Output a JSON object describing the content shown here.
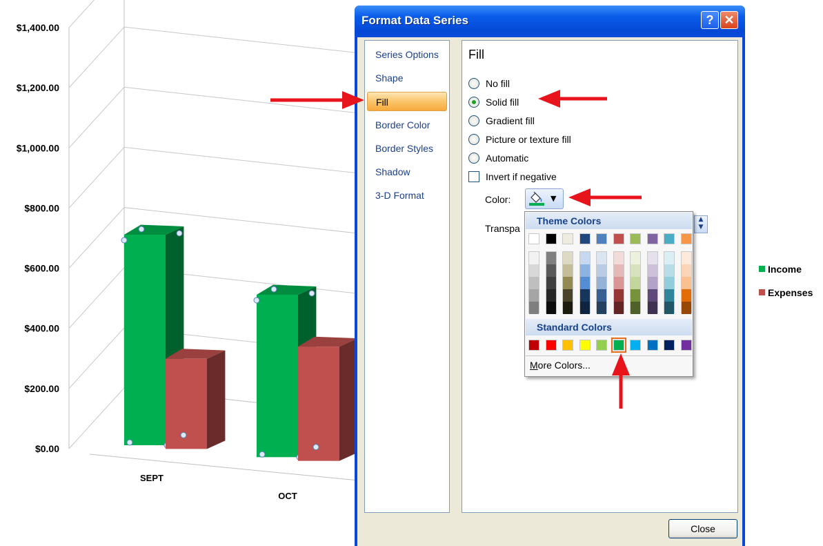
{
  "chart_data": {
    "type": "bar",
    "categories": [
      "SEPT",
      "OCT"
    ],
    "series": [
      {
        "name": "Income",
        "color": "#00b050",
        "values": [
          700,
          540
        ]
      },
      {
        "name": "Expenses",
        "color": "#c0504d",
        "values": [
          300,
          380
        ]
      }
    ],
    "ylim": [
      0,
      1400
    ],
    "yticks": [
      "$0.00",
      "$200.00",
      "$400.00",
      "$600.00",
      "$800.00",
      "$1,000.00",
      "$1,200.00",
      "$1,400.00"
    ],
    "grid": true,
    "legend_position": "right",
    "style": "3-D clustered column"
  },
  "dialog": {
    "title": "Format Data Series",
    "help_label": "?",
    "close_x_label": "✕",
    "nav_items": [
      {
        "label": "Series Options"
      },
      {
        "label": "Shape"
      },
      {
        "label": "Fill"
      },
      {
        "label": "Border Color"
      },
      {
        "label": "Border Styles"
      },
      {
        "label": "Shadow"
      },
      {
        "label": "3-D Format"
      }
    ],
    "selected_nav": "Fill",
    "fill": {
      "heading": "Fill",
      "options": [
        {
          "label": "No fill",
          "checked": false
        },
        {
          "label": "Solid fill",
          "checked": true
        },
        {
          "label": "Gradient fill",
          "checked": false
        },
        {
          "label": "Picture or texture fill",
          "checked": false
        },
        {
          "label": "Automatic",
          "checked": false
        }
      ],
      "invert_label": "Invert if negative",
      "invert_checked": false,
      "color_label": "Color:",
      "color_button_icon": "paint-bucket-icon",
      "color_value": "#00b050",
      "transparency_label": "Transpa"
    },
    "close_button": "Close"
  },
  "color_dropdown": {
    "theme_header": "Theme Colors",
    "theme_top": [
      "#ffffff",
      "#000000",
      "#eeece1",
      "#1f497d",
      "#4f81bd",
      "#c0504d",
      "#9bbb59",
      "#8064a2",
      "#4bacc6",
      "#f79646"
    ],
    "theme_shades": [
      [
        "#f2f2f2",
        "#d8d8d8",
        "#bfbfbf",
        "#a5a5a5",
        "#7f7f7f"
      ],
      [
        "#7f7f7f",
        "#595959",
        "#3f3f3f",
        "#262626",
        "#0c0c0c"
      ],
      [
        "#ddd9c3",
        "#c4bd97",
        "#938953",
        "#494429",
        "#1d1b10"
      ],
      [
        "#c6d9f0",
        "#8db3e2",
        "#548dd4",
        "#17365d",
        "#0f243e"
      ],
      [
        "#dbe5f1",
        "#b8cce4",
        "#95b3d7",
        "#366092",
        "#244061"
      ],
      [
        "#f2dcdb",
        "#e5b9b7",
        "#d99694",
        "#953734",
        "#632423"
      ],
      [
        "#ebf1dd",
        "#d7e3bc",
        "#c3d69b",
        "#76923c",
        "#4f6128"
      ],
      [
        "#e5e0ec",
        "#ccc1d9",
        "#b2a2c7",
        "#5f497a",
        "#3f3151"
      ],
      [
        "#dbeef3",
        "#b7dde8",
        "#92cddc",
        "#31859b",
        "#205867"
      ],
      [
        "#fdeada",
        "#fbd5b5",
        "#fac08f",
        "#e36c09",
        "#974806"
      ]
    ],
    "standard_header": "Standard Colors",
    "standard": [
      "#c00000",
      "#ff0000",
      "#ffc000",
      "#ffff00",
      "#92d050",
      "#00b050",
      "#00b0f0",
      "#0070c0",
      "#002060",
      "#7030a0"
    ],
    "selected_standard_index": 5,
    "more_colors_underlined": "M",
    "more_colors_rest": "ore Colors..."
  }
}
